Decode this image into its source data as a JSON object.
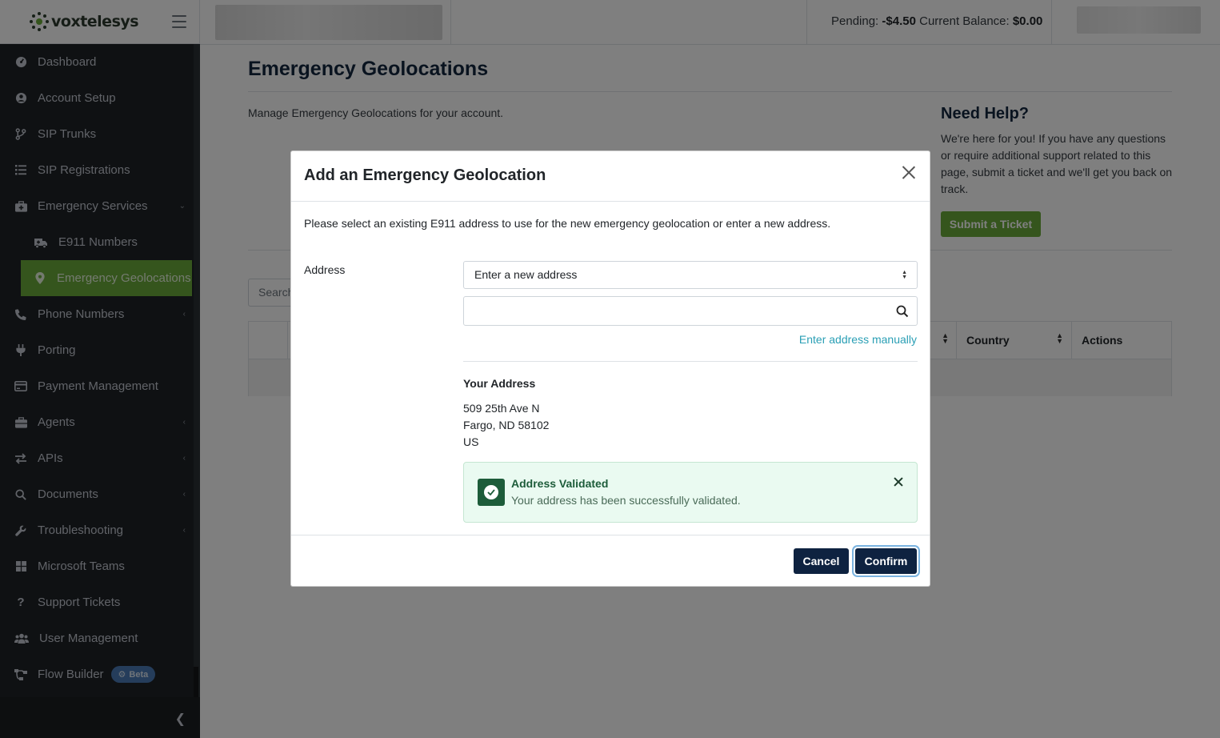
{
  "brand": {
    "name_prefix": "vox",
    "name_suffix": "telesys"
  },
  "topbar": {
    "pending_label": "Pending:",
    "pending_value": "-$4.50",
    "balance_label": "Current Balance:",
    "balance_value": "$0.00"
  },
  "sidebar": {
    "items": [
      {
        "label": "Dashboard",
        "icon": "dashboard-icon"
      },
      {
        "label": "Account Setup",
        "icon": "user-circle-icon"
      },
      {
        "label": "SIP Trunks",
        "icon": "branch-icon"
      },
      {
        "label": "SIP Registrations",
        "icon": "list-icon"
      },
      {
        "label": "Emergency Services",
        "icon": "medkit-icon"
      },
      {
        "label": "E911 Numbers",
        "icon": "ambulance-icon"
      },
      {
        "label": "Emergency Geolocations",
        "icon": "map-pin-icon"
      },
      {
        "label": "Phone Numbers",
        "icon": "phone-icon"
      },
      {
        "label": "Porting",
        "icon": "plug-icon"
      },
      {
        "label": "Payment Management",
        "icon": "credit-card-icon"
      },
      {
        "label": "Agents",
        "icon": "briefcase-icon"
      },
      {
        "label": "APIs",
        "icon": "exchange-icon"
      },
      {
        "label": "Documents",
        "icon": "search-icon"
      },
      {
        "label": "Troubleshooting",
        "icon": "wrench-icon"
      },
      {
        "label": "Microsoft Teams",
        "icon": "windows-icon"
      },
      {
        "label": "Support Tickets",
        "icon": "question-icon"
      },
      {
        "label": "User Management",
        "icon": "users-icon"
      },
      {
        "label": "Flow Builder",
        "icon": "sitemap-icon"
      }
    ],
    "beta_badge": "Beta"
  },
  "page": {
    "title": "Emergency Geolocations",
    "description": "Manage Emergency Geolocations for your account.",
    "search_placeholder": "Search"
  },
  "help": {
    "title": "Need Help?",
    "text": "We're here for you! If you have any questions or require additional support related to this page, submit a ticket and we'll get you back on track.",
    "button": "Submit a Ticket"
  },
  "table": {
    "columns": [
      "Country",
      "Actions"
    ]
  },
  "modal": {
    "title": "Add an Emergency Geolocation",
    "intro": "Please select an existing E911 address to use for the new emergency geolocation or enter a new address.",
    "address_label": "Address",
    "select_value": "Enter a new address",
    "search_value": "",
    "manual_link": "Enter address manually",
    "your_address_title": "Your Address",
    "address_line1": "509 25th Ave N",
    "address_line2": "Fargo, ND 58102",
    "address_line3": "US",
    "alert_title": "Address Validated",
    "alert_message": "Your address has been successfully validated.",
    "cancel": "Cancel",
    "confirm": "Confirm"
  },
  "colors": {
    "accent_green": "#6aaa3a",
    "navy": "#0e2240",
    "sidebar_bg": "#1f2327",
    "link": "#2a9fb5"
  }
}
